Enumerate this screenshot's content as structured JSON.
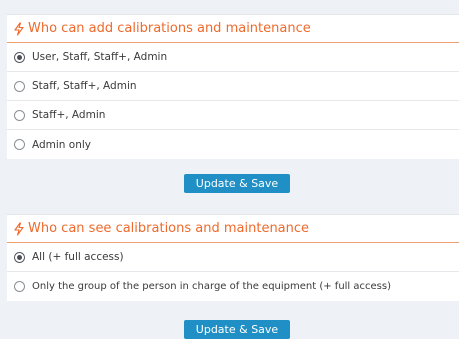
{
  "section_add": {
    "title": "Who can add calibrations and maintenance",
    "options": [
      {
        "label": "User, Staff, Staff+, Admin",
        "checked": true
      },
      {
        "label": "Staff, Staff+, Admin",
        "checked": false
      },
      {
        "label": "Staff+, Admin",
        "checked": false
      },
      {
        "label": "Admin only",
        "checked": false
      }
    ],
    "button": "Update & Save"
  },
  "section_see": {
    "title": "Who can see calibrations and maintenance",
    "options": [
      {
        "label": "All (+ full access)",
        "checked": true
      },
      {
        "label": "Only the group of the person in charge of the equipment (+ full access)",
        "checked": false
      }
    ],
    "button": "Update & Save"
  },
  "colors": {
    "accent": "#ee6a2c",
    "button": "#1f8fc6",
    "background": "#eef1f5"
  }
}
